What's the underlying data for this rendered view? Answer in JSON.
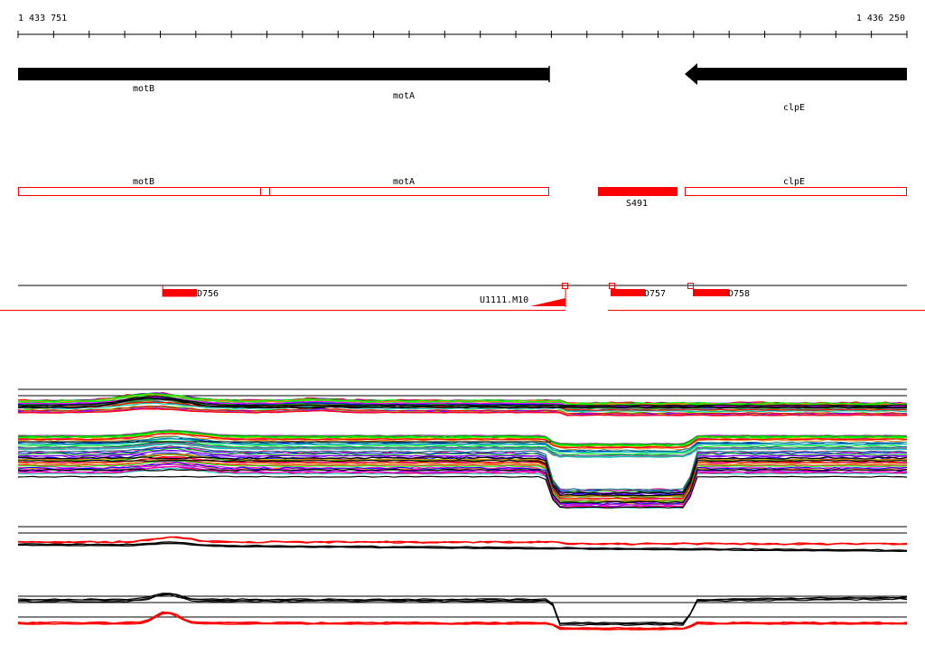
{
  "coords": {
    "start": "1 433 751",
    "end": "1 436 250"
  },
  "genes": [
    {
      "name": "motB"
    },
    {
      "name": "motA"
    },
    {
      "name": "clpE"
    }
  ],
  "annotations": {
    "boxes": [
      {
        "label": "motB"
      },
      {
        "label": "motA"
      },
      {
        "label": "clpE"
      }
    ],
    "filled": {
      "label": "S491"
    }
  },
  "features": [
    {
      "label": "D756"
    },
    {
      "label": "U1111.M10"
    },
    {
      "label": "D757"
    },
    {
      "label": "D758"
    }
  ],
  "colors": {
    "gene_arrow": "#000000",
    "annotation": "#ff0000",
    "lines": [
      "#ff0000",
      "#00a000",
      "#0000ff",
      "#ff00ff",
      "#00c0c0",
      "#c0c000",
      "#ff8000",
      "#8000ff",
      "#808080",
      "#00ff00",
      "#ff0080",
      "#008080"
    ]
  }
}
